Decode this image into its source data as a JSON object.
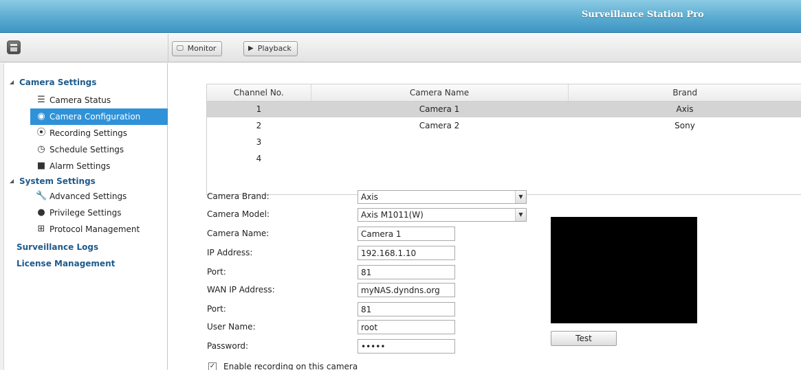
{
  "app": {
    "title": "Surveillance Station Pro"
  },
  "toolbar": {
    "menu_icon": "app-menu-icon",
    "monitor_label": "Monitor",
    "monitor_icon": "monitor-icon",
    "playback_label": "Playback",
    "playback_icon": "play-icon"
  },
  "sidebar": {
    "groups": [
      {
        "label": "Camera Settings",
        "items": [
          {
            "label": "Camera Status",
            "icon": "list-icon"
          },
          {
            "label": "Camera Configuration",
            "icon": "camera-icon",
            "active": true
          },
          {
            "label": "Recording Settings",
            "icon": "record-icon"
          },
          {
            "label": "Schedule Settings",
            "icon": "clock-icon"
          },
          {
            "label": "Alarm Settings",
            "icon": "alarm-icon"
          }
        ]
      },
      {
        "label": "System Settings",
        "items": [
          {
            "label": "Advanced Settings",
            "icon": "wrench-icon"
          },
          {
            "label": "Privilege Settings",
            "icon": "user-icon"
          },
          {
            "label": "Protocol Management",
            "icon": "network-icon"
          }
        ]
      }
    ],
    "links": [
      {
        "label": "Surveillance Logs"
      },
      {
        "label": "License Management"
      }
    ]
  },
  "table": {
    "columns": [
      "Channel No.",
      "Camera Name",
      "Brand"
    ],
    "rows": [
      [
        "1",
        "Camera 1",
        "Axis"
      ],
      [
        "2",
        "Camera 2",
        "Sony"
      ],
      [
        "3",
        "",
        ""
      ],
      [
        "4",
        "",
        ""
      ]
    ],
    "selected_row": 0
  },
  "form": {
    "camera_brand": {
      "label": "Camera Brand:",
      "value": "Axis"
    },
    "camera_model": {
      "label": "Camera Model:",
      "value": "Axis M1011(W)"
    },
    "camera_name": {
      "label": "Camera Name:",
      "value": "Camera 1"
    },
    "ip_address": {
      "label": "IP Address:",
      "value": "192.168.1.10"
    },
    "port": {
      "label": "Port:",
      "value": "81"
    },
    "wan_ip": {
      "label": "WAN IP Address:",
      "value": "myNAS.dyndns.org"
    },
    "wan_port": {
      "label": "Port:",
      "value": "81"
    },
    "user_name": {
      "label": "User Name:",
      "value": "root"
    },
    "password": {
      "label": "Password:",
      "value": "•••••"
    },
    "test_label": "Test",
    "enable_recording": {
      "label": "Enable recording on this camera",
      "checked": true
    }
  },
  "colors": {
    "titlebar": "#5eaed2",
    "sidebar_active": "#2f92d8",
    "group_text": "#1e5a8c",
    "preview_bg": "#000000"
  }
}
